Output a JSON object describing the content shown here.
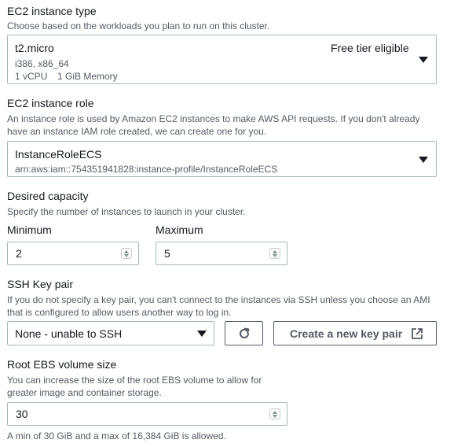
{
  "instance_type": {
    "label": "EC2 instance type",
    "description": "Choose based on the workloads you plan to run on this cluster.",
    "selected": {
      "name": "t2.micro",
      "badge": "Free tier eligible",
      "arch": "i386, x86_64",
      "vcpu": "1 vCPU",
      "memory": "1 GiB Memory"
    }
  },
  "instance_role": {
    "label": "EC2 instance role",
    "description_line1": "An instance role is used by Amazon EC2 instances to make AWS API requests. If you don't already",
    "description_line2": "have an instance IAM role created, we can create one for you.",
    "selected": {
      "name": "InstanceRoleECS",
      "arn": "arn:aws:iam::754351941828:instance-profile/InstanceRoleECS"
    }
  },
  "desired_capacity": {
    "label": "Desired capacity",
    "description": "Specify the number of instances to launch in your cluster.",
    "minimum": {
      "label": "Minimum",
      "value": "2"
    },
    "maximum": {
      "label": "Maximum",
      "value": "5"
    }
  },
  "ssh_key_pair": {
    "label": "SSH Key pair",
    "description_line1": "If you do not specify a key pair, you can't connect to the instances via SSH unless you choose an AMI",
    "description_line2": "that is configured to allow users another way to log in.",
    "selected": "None - unable to SSH",
    "create_button": "Create a new key pair"
  },
  "root_ebs": {
    "label": "Root EBS volume size",
    "description_line1": "You can increase the size of the root EBS volume to allow for",
    "description_line2": "greater image and container storage.",
    "value": "30",
    "constraint": "A min of 30 GiB and a max of 16,384 GiB is allowed."
  }
}
